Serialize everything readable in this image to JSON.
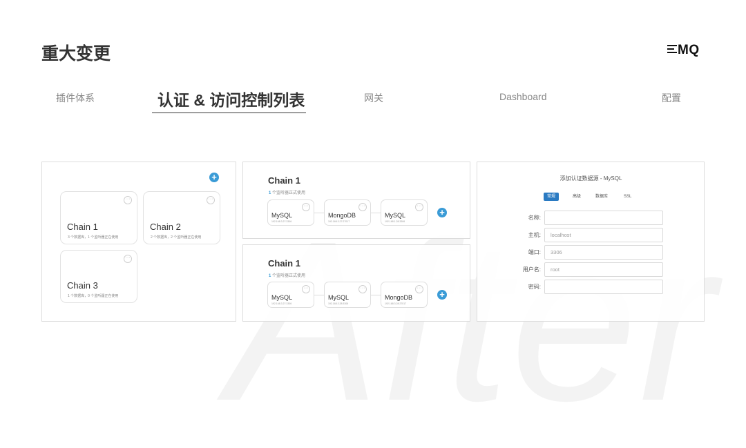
{
  "watermark": "After",
  "header": {
    "title": "重大变更",
    "logo_text": "MQ"
  },
  "nav": {
    "tabs": [
      {
        "label": "插件体系"
      },
      {
        "label": "认证 & 访问控制列表",
        "active": true
      },
      {
        "label": "网关"
      },
      {
        "label": "Dashboard"
      },
      {
        "label": "配置"
      }
    ]
  },
  "chain_list": {
    "add_icon": "plus-icon",
    "cards": [
      {
        "name": "Chain 1",
        "desc": "3 个数据库，1 个监听器正在使用"
      },
      {
        "name": "Chain 2",
        "desc": "2 个数据库，2 个监听器正在使用"
      },
      {
        "name": "Chain 3",
        "desc": "1 个数据库，0 个监听器正在使用"
      }
    ]
  },
  "chain_flows": [
    {
      "title": "Chain 1",
      "sub_count": "1",
      "sub_text": " 个监听器正式使用",
      "nodes": [
        {
          "name": "MySQL",
          "addr": "192.168.3.27:3306"
        },
        {
          "name": "MongoDB",
          "addr": "192.168.3.27:27017"
        },
        {
          "name": "MySQL",
          "addr": "192.168.1.28:3306"
        }
      ]
    },
    {
      "title": "Chain 1",
      "sub_count": "1",
      "sub_text": " 个监听器正式使用",
      "nodes": [
        {
          "name": "MySQL",
          "addr": "192.168.3.27:3306"
        },
        {
          "name": "MySQL",
          "addr": "192.168.3.28:3306"
        },
        {
          "name": "MongoDB",
          "addr": "192.168.3.28:27017"
        }
      ]
    }
  ],
  "form": {
    "title": "添加认证数据源 - MySQL",
    "tabs": [
      "常规",
      "高级",
      "数据库",
      "SSL"
    ],
    "active_tab": "常规",
    "fields": [
      {
        "label": "名称:",
        "value": ""
      },
      {
        "label": "主机:",
        "value": "localhost"
      },
      {
        "label": "端口:",
        "value": "3306"
      },
      {
        "label": "用户名:",
        "value": "root"
      },
      {
        "label": "密码:",
        "value": ""
      }
    ]
  },
  "colors": {
    "accent": "#3a9bd6",
    "active_tab": "#2a7ac2",
    "text": "#333333"
  }
}
